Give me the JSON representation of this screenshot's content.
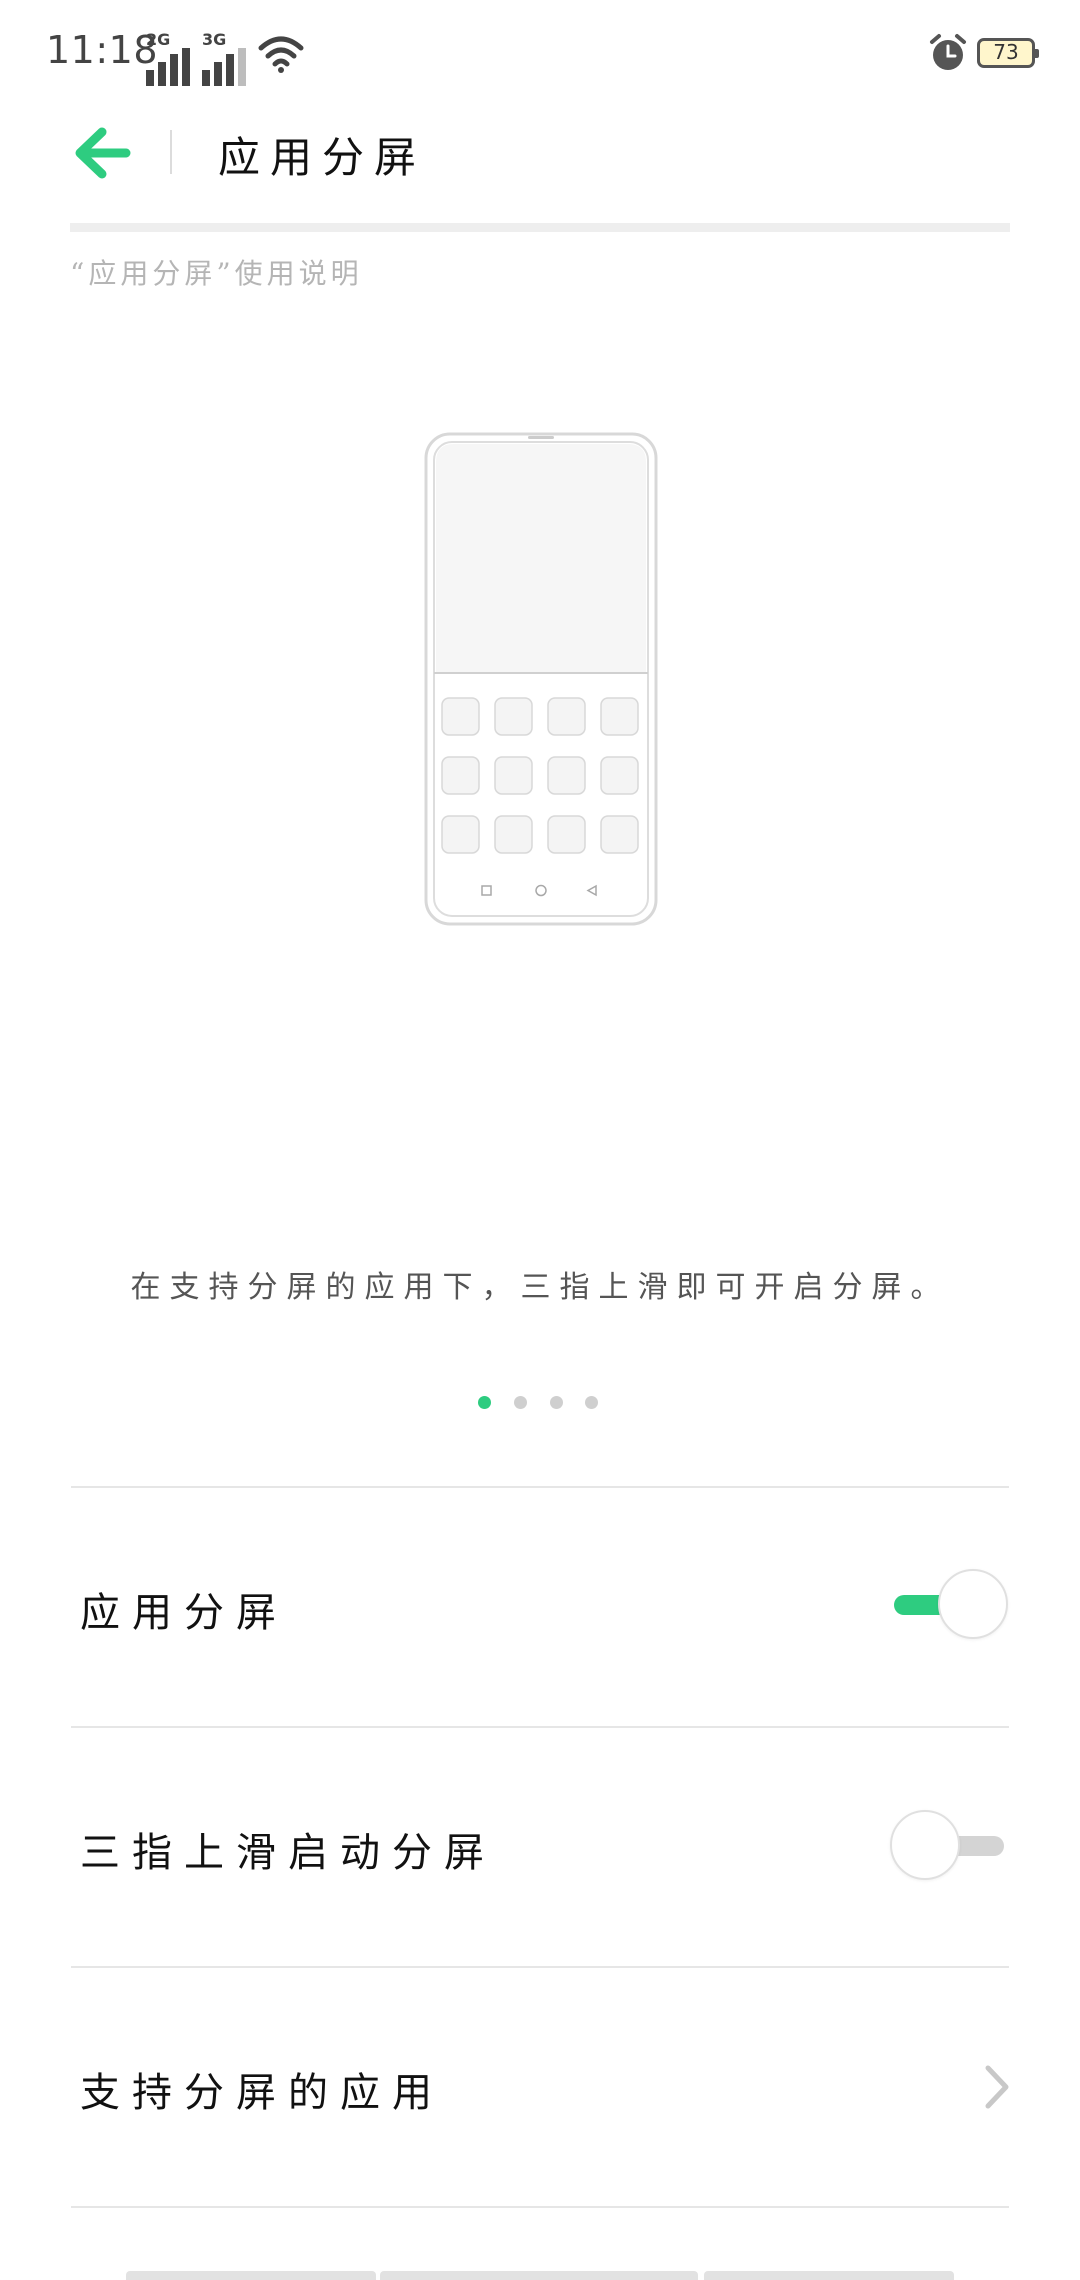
{
  "status_bar": {
    "time": "11:18",
    "network_1": "2G",
    "network_2": "3G",
    "battery": "73",
    "icons": [
      "signal-icon",
      "signal-icon",
      "wifi-icon",
      "alarm-icon",
      "battery-icon"
    ]
  },
  "header": {
    "back_icon": "arrow-left-icon",
    "title": "应用分屏"
  },
  "usage_caption": "“应用分屏”使用说明",
  "guide": {
    "text": "在支持分屏的应用下，三指上滑即可开启分屏。",
    "pages": 4,
    "active_page": 1
  },
  "settings": {
    "items": [
      {
        "label": "应用分屏",
        "type": "switch",
        "on": true
      },
      {
        "label": "三指上滑启动分屏",
        "type": "switch",
        "on": false
      },
      {
        "label": "支持分屏的应用",
        "type": "link",
        "icon": "chevron-right-icon"
      }
    ]
  },
  "colors": {
    "accent": "#2ecc80",
    "divider": "#e6e6e6",
    "track_off": "#d4d4d4"
  }
}
